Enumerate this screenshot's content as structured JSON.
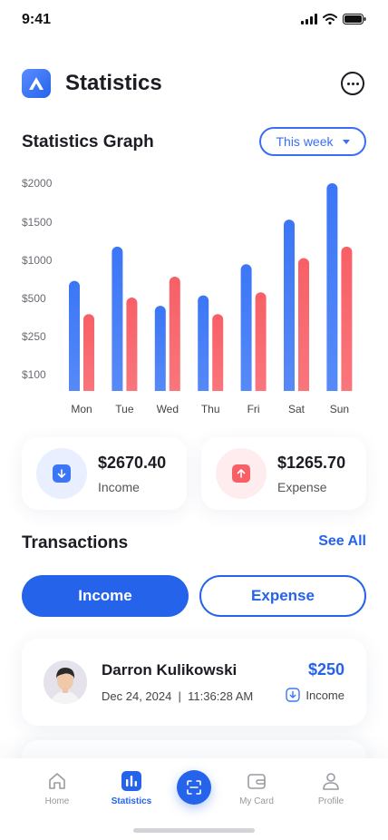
{
  "status_bar": {
    "time": "9:41"
  },
  "header": {
    "title": "Statistics"
  },
  "graph": {
    "title": "Statistics Graph",
    "period": "This week"
  },
  "chart_data": {
    "type": "bar",
    "categories": [
      "Mon",
      "Tue",
      "Wed",
      "Thu",
      "Fri",
      "Sat",
      "Sun"
    ],
    "y_ticks": [
      "$2000",
      "$1500",
      "$1000",
      "$500",
      "$250",
      "$100"
    ],
    "series": [
      {
        "color": "#3b76f6",
        "values": [
          1060,
          1390,
          820,
          920,
          1220,
          1650,
          2000
        ]
      },
      {
        "color": "#f85f66",
        "values": [
          740,
          900,
          1100,
          740,
          950,
          1280,
          1390
        ]
      }
    ],
    "grid": false,
    "legend": "none"
  },
  "summary": {
    "income": {
      "amount": "$2670.40",
      "label": "Income"
    },
    "expense": {
      "amount": "$1265.70",
      "label": "Expense"
    }
  },
  "transactions": {
    "title": "Transactions",
    "see_all": "See All",
    "tabs": {
      "income": "Income",
      "expense": "Expense"
    },
    "items": [
      {
        "name": "Darron Kulikowski",
        "date": "Dec 24, 2024  |  11:36:28 AM",
        "amount": "$250",
        "type": "Income"
      }
    ]
  },
  "tab_bar": {
    "items": [
      {
        "label": "Home",
        "icon": "home-icon"
      },
      {
        "label": "Statistics",
        "icon": "bar-chart-icon"
      },
      {
        "label": "",
        "icon": "scan-icon"
      },
      {
        "label": "My Card",
        "icon": "wallet-icon"
      },
      {
        "label": "Profile",
        "icon": "user-icon"
      }
    ],
    "active": "Statistics"
  },
  "colors": {
    "accent": "#2563eb",
    "income_bar": "#3b76f6",
    "expense_bar": "#f85f66"
  }
}
